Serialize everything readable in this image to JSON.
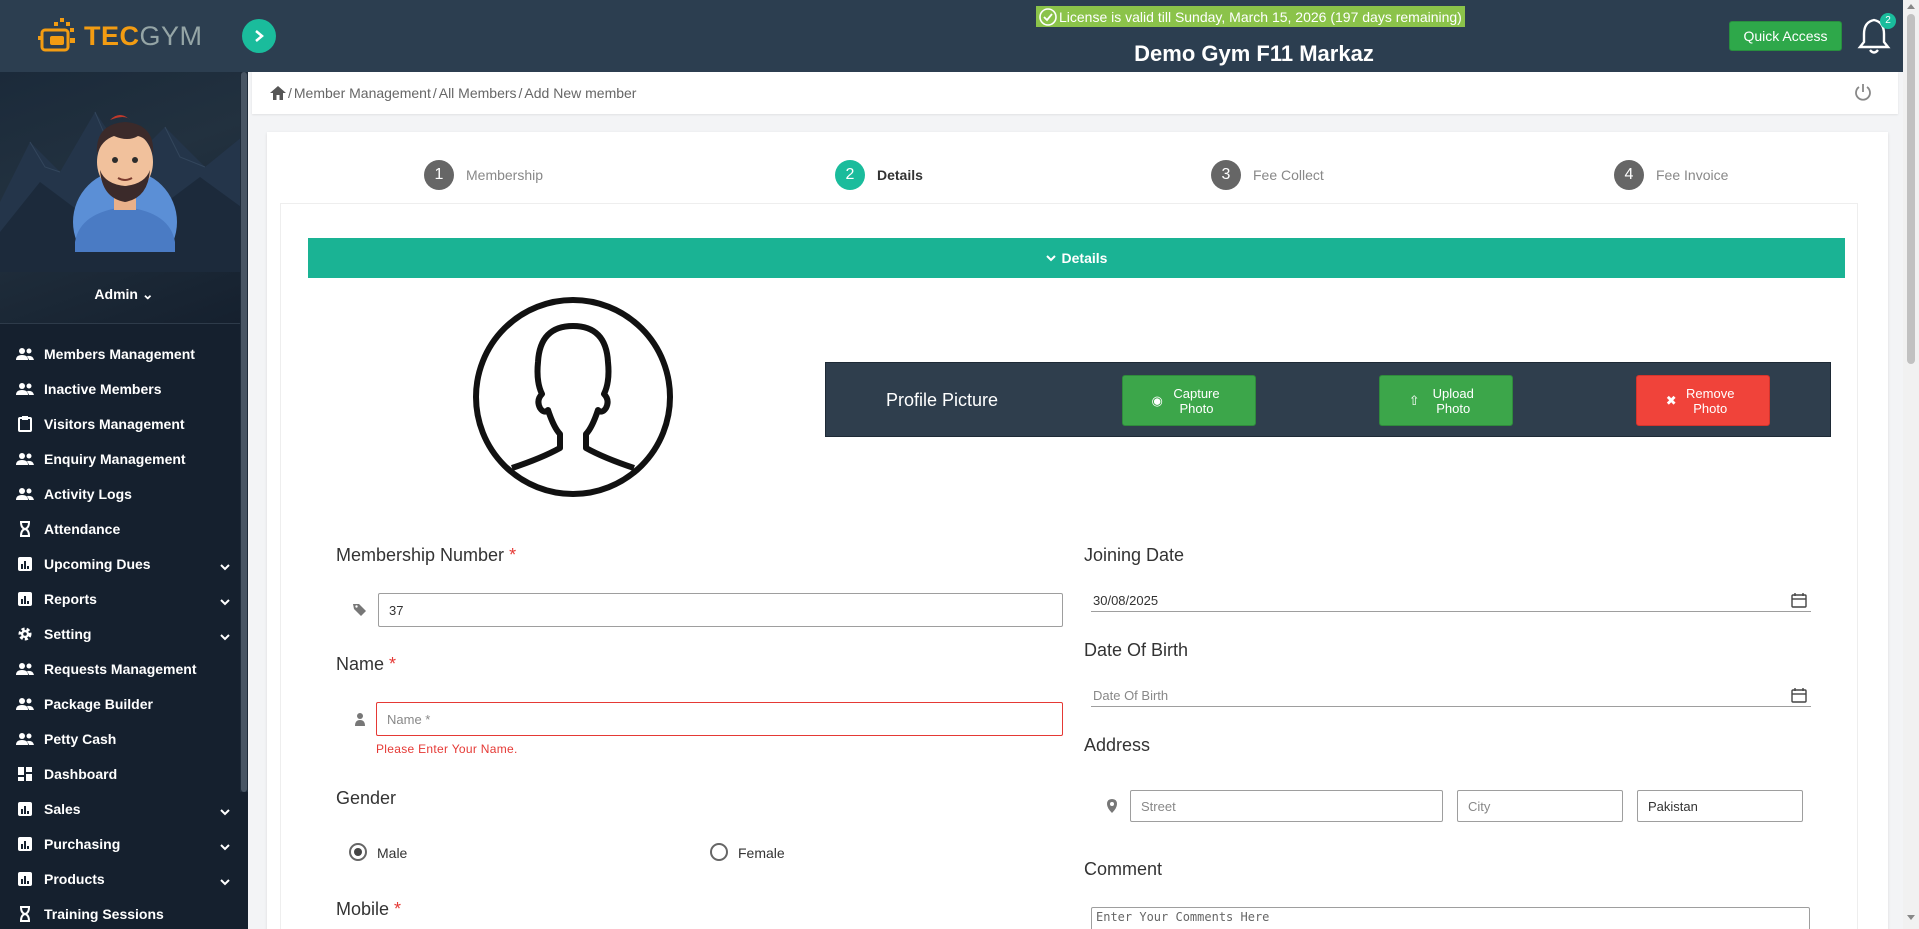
{
  "brand": {
    "tec": "TEC",
    "gym": "GYM"
  },
  "topbar": {
    "license": "License is valid till Sunday, March 15, 2026 (197 days remaining)",
    "gym_name": "Demo Gym F11 Markaz",
    "quick_access": "Quick Access",
    "notifications_count": "2"
  },
  "sidebar": {
    "user": "Admin",
    "items": [
      {
        "label": "Members Management",
        "icon": "users-icon"
      },
      {
        "label": "Inactive Members",
        "icon": "users-icon"
      },
      {
        "label": "Visitors Management",
        "icon": "clipboard-icon"
      },
      {
        "label": "Enquiry Management",
        "icon": "users-icon"
      },
      {
        "label": "Activity Logs",
        "icon": "users-icon"
      },
      {
        "label": "Attendance",
        "icon": "hourglass-icon"
      },
      {
        "label": "Upcoming Dues",
        "icon": "bar-chart-icon"
      },
      {
        "label": "Reports",
        "icon": "bar-chart-icon"
      },
      {
        "label": "Setting",
        "icon": "gear-icon"
      },
      {
        "label": "Requests Management",
        "icon": "users-icon"
      },
      {
        "label": "Package Builder",
        "icon": "users-icon"
      },
      {
        "label": "Petty Cash",
        "icon": "users-icon"
      },
      {
        "label": "Dashboard",
        "icon": "dashboard-icon"
      },
      {
        "label": "Sales",
        "icon": "bar-chart-icon"
      },
      {
        "label": "Purchasing",
        "icon": "bar-chart-icon"
      },
      {
        "label": "Products",
        "icon": "bar-chart-icon"
      },
      {
        "label": "Training Sessions",
        "icon": "hourglass-icon"
      }
    ]
  },
  "breadcrumb": [
    "Member Management",
    "All Members",
    "Add New member"
  ],
  "steps": [
    {
      "num": "1",
      "label": "Membership"
    },
    {
      "num": "2",
      "label": "Details"
    },
    {
      "num": "3",
      "label": "Fee Collect"
    },
    {
      "num": "4",
      "label": "Fee Invoice"
    }
  ],
  "section_title": "Details",
  "profile_picture": {
    "label": "Profile Picture",
    "capture": "Capture Photo",
    "upload": "Upload Photo",
    "remove": "Remove Photo"
  },
  "form": {
    "membership_number_label": "Membership Number",
    "membership_number_value": "37",
    "name_label": "Name",
    "name_placeholder": "Name *",
    "name_error": "Please Enter Your Name.",
    "gender_label": "Gender",
    "gender_male": "Male",
    "gender_female": "Female",
    "mobile_label": "Mobile",
    "required_mark": "*",
    "joining_date_label": "Joining Date",
    "joining_date_value": "30/08/2025",
    "dob_label": "Date Of Birth",
    "dob_placeholder": "Date Of Birth",
    "address_label": "Address",
    "street_placeholder": "Street",
    "city_placeholder": "City",
    "country_value": "Pakistan",
    "comment_label": "Comment",
    "comment_placeholder": "Enter Your Comments Here"
  },
  "colors": {
    "accent": "#1abc9c",
    "sidebar": "#15202e",
    "topbar": "#2c3e50",
    "license": "#8bc34a",
    "danger": "#f0433a",
    "success": "#3ca64a"
  }
}
